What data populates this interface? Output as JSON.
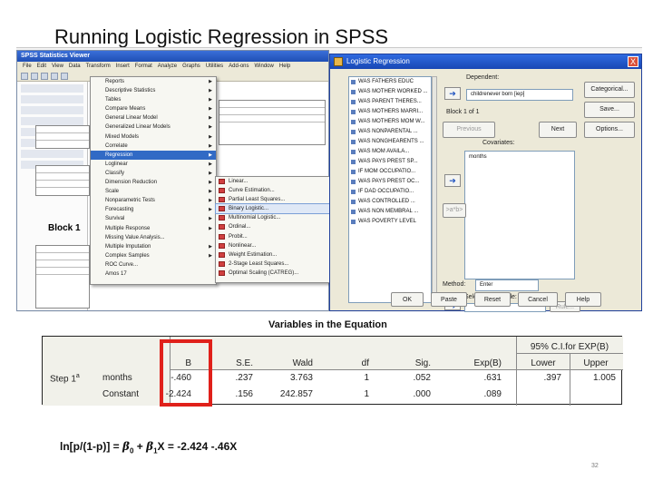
{
  "slide": {
    "title": "Running Logistic Regression in SPSS",
    "page_number": "32"
  },
  "viewer": {
    "title": "SPSS Statistics Viewer",
    "menus": [
      "File",
      "Edit",
      "View",
      "Data",
      "Transform",
      "Insert",
      "Format",
      "Analyze",
      "Graphs",
      "Utilities",
      "Add-ons",
      "Window",
      "Help"
    ],
    "block_label": "Block 1"
  },
  "analyze_menu": {
    "items": [
      "Reports",
      "Descriptive Statistics",
      "Tables",
      "Compare Means",
      "General Linear Model",
      "Generalized Linear Models",
      "Mixed Models",
      "Correlate",
      "Regression",
      "Loglinear",
      "Classify",
      "Dimension Reduction",
      "Scale",
      "Nonparametric Tests",
      "Forecasting",
      "Survival",
      "Multiple Response",
      "Missing Value Analysis...",
      "Multiple Imputation",
      "Complex Samples",
      "ROC Curve...",
      "Amos 17"
    ],
    "active_index": 8
  },
  "regression_menu": {
    "items": [
      "Linear...",
      "Curve Estimation...",
      "Partial Least Squares...",
      "Binary Logistic...",
      "Multinomial Logistic...",
      "Ordinal...",
      "Probit...",
      "Nonlinear...",
      "Weight Estimation...",
      "2-Stage Least Squares...",
      "Optimal Scaling (CATREG)..."
    ],
    "hover_index": 3
  },
  "dialog": {
    "title": "Logistic Regression",
    "close": "X",
    "dependent_label": "Dependent:",
    "dependent_value": "childrenever born [iep]",
    "block_label": "Block 1 of 1",
    "previous": "Previous",
    "next": "Next",
    "covariates_label": "Covariates:",
    "covariates_value": "months",
    "method_label": "Method:",
    "method_value": "Enter",
    "selection_label": "Selection Variable:",
    "rule_button": "Rule...",
    "ab_button": ">a*b>",
    "buttons": [
      "Categorical...",
      "Save...",
      "Options..."
    ],
    "footer_buttons": [
      "OK",
      "Paste",
      "Reset",
      "Cancel",
      "Help"
    ],
    "variables": [
      "WAS FATHERS EDUC",
      "WAS MOTHER WORKED ...",
      "WAS PARENT THERES...",
      "WAS MOTHERS MARRI...",
      "WAS MOTHERS MOM W...",
      "WAS NONPARENTAL ...",
      "WAS NONGHEARENTS ...",
      "WAS MOM AVAILA...",
      "WAS PAYS PREST SP...",
      "IF MOM OCCUPATIO...",
      "WAS PAYS PREST OC...",
      "IF DAD OCCUPATIO...",
      "WAS CONTROLLED ...",
      "WAS NON MEMBRAL ...",
      "WAS POVERTY LEVEL"
    ]
  },
  "edge_fragments": [
    "V",
    "V",
    "V",
    "V",
    "V",
    "V",
    "I",
    "F-",
    "CO",
    "F:",
    "re",
    "Fi",
    "B",
    "#",
    "V",
    "V",
    "V",
    "CO"
  ],
  "results_table": {
    "title": "Variables in the Equation",
    "ci_header": "95% C.I.for EXP(B)",
    "columns": [
      "B",
      "S.E.",
      "Wald",
      "df",
      "Sig.",
      "Exp(B)",
      "Lower",
      "Upper"
    ],
    "step_label": "Step 1",
    "step_superscript": "a",
    "rows": [
      {
        "name": "months",
        "B": "-.460",
        "SE": ".237",
        "Wald": "3.763",
        "df": "1",
        "Sig": ".052",
        "ExpB": ".631",
        "Lower": ".397",
        "Upper": "1.005"
      },
      {
        "name": "Constant",
        "B": "-2.424",
        "SE": ".156",
        "Wald": "242.857",
        "df": "1",
        "Sig": ".000",
        "ExpB": ".089",
        "Lower": "",
        "Upper": ""
      }
    ],
    "highlight_color": "#e0201a"
  },
  "formula": {
    "lhs": "ln[p/(1-p)] = ",
    "beta0": "β",
    "beta0_sub": "0",
    "plus": " + ",
    "beta1": "β",
    "beta1_sub": "1",
    "x": "X",
    "rhs": " =  -2.424 -.46X"
  }
}
